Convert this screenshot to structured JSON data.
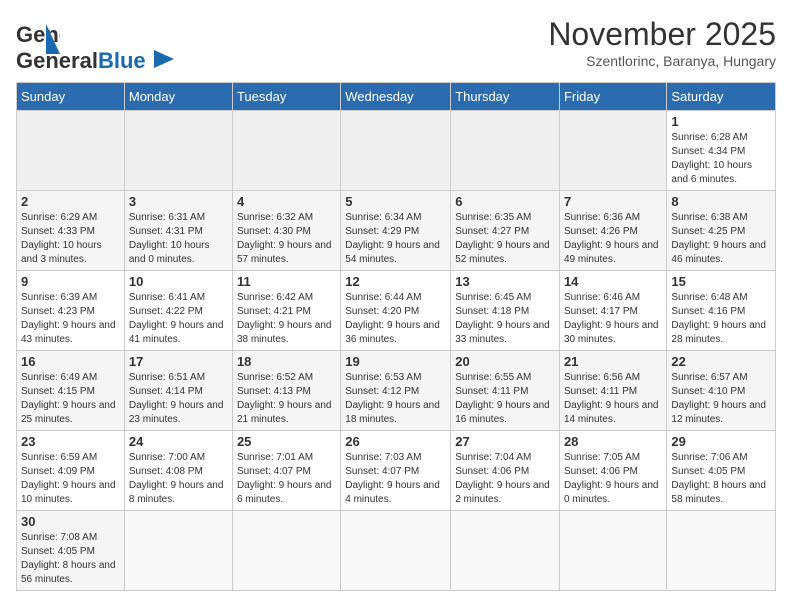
{
  "header": {
    "logo_general": "General",
    "logo_blue": "Blue",
    "month_title": "November 2025",
    "subtitle": "Szentlorinc, Baranya, Hungary"
  },
  "weekdays": [
    "Sunday",
    "Monday",
    "Tuesday",
    "Wednesday",
    "Thursday",
    "Friday",
    "Saturday"
  ],
  "weeks": [
    [
      {
        "day": "",
        "info": ""
      },
      {
        "day": "",
        "info": ""
      },
      {
        "day": "",
        "info": ""
      },
      {
        "day": "",
        "info": ""
      },
      {
        "day": "",
        "info": ""
      },
      {
        "day": "",
        "info": ""
      },
      {
        "day": "1",
        "info": "Sunrise: 6:28 AM\nSunset: 4:34 PM\nDaylight: 10 hours and 6 minutes."
      }
    ],
    [
      {
        "day": "2",
        "info": "Sunrise: 6:29 AM\nSunset: 4:33 PM\nDaylight: 10 hours and 3 minutes."
      },
      {
        "day": "3",
        "info": "Sunrise: 6:31 AM\nSunset: 4:31 PM\nDaylight: 10 hours and 0 minutes."
      },
      {
        "day": "4",
        "info": "Sunrise: 6:32 AM\nSunset: 4:30 PM\nDaylight: 9 hours and 57 minutes."
      },
      {
        "day": "5",
        "info": "Sunrise: 6:34 AM\nSunset: 4:29 PM\nDaylight: 9 hours and 54 minutes."
      },
      {
        "day": "6",
        "info": "Sunrise: 6:35 AM\nSunset: 4:27 PM\nDaylight: 9 hours and 52 minutes."
      },
      {
        "day": "7",
        "info": "Sunrise: 6:36 AM\nSunset: 4:26 PM\nDaylight: 9 hours and 49 minutes."
      },
      {
        "day": "8",
        "info": "Sunrise: 6:38 AM\nSunset: 4:25 PM\nDaylight: 9 hours and 46 minutes."
      }
    ],
    [
      {
        "day": "9",
        "info": "Sunrise: 6:39 AM\nSunset: 4:23 PM\nDaylight: 9 hours and 43 minutes."
      },
      {
        "day": "10",
        "info": "Sunrise: 6:41 AM\nSunset: 4:22 PM\nDaylight: 9 hours and 41 minutes."
      },
      {
        "day": "11",
        "info": "Sunrise: 6:42 AM\nSunset: 4:21 PM\nDaylight: 9 hours and 38 minutes."
      },
      {
        "day": "12",
        "info": "Sunrise: 6:44 AM\nSunset: 4:20 PM\nDaylight: 9 hours and 36 minutes."
      },
      {
        "day": "13",
        "info": "Sunrise: 6:45 AM\nSunset: 4:18 PM\nDaylight: 9 hours and 33 minutes."
      },
      {
        "day": "14",
        "info": "Sunrise: 6:46 AM\nSunset: 4:17 PM\nDaylight: 9 hours and 30 minutes."
      },
      {
        "day": "15",
        "info": "Sunrise: 6:48 AM\nSunset: 4:16 PM\nDaylight: 9 hours and 28 minutes."
      }
    ],
    [
      {
        "day": "16",
        "info": "Sunrise: 6:49 AM\nSunset: 4:15 PM\nDaylight: 9 hours and 25 minutes."
      },
      {
        "day": "17",
        "info": "Sunrise: 6:51 AM\nSunset: 4:14 PM\nDaylight: 9 hours and 23 minutes."
      },
      {
        "day": "18",
        "info": "Sunrise: 6:52 AM\nSunset: 4:13 PM\nDaylight: 9 hours and 21 minutes."
      },
      {
        "day": "19",
        "info": "Sunrise: 6:53 AM\nSunset: 4:12 PM\nDaylight: 9 hours and 18 minutes."
      },
      {
        "day": "20",
        "info": "Sunrise: 6:55 AM\nSunset: 4:11 PM\nDaylight: 9 hours and 16 minutes."
      },
      {
        "day": "21",
        "info": "Sunrise: 6:56 AM\nSunset: 4:11 PM\nDaylight: 9 hours and 14 minutes."
      },
      {
        "day": "22",
        "info": "Sunrise: 6:57 AM\nSunset: 4:10 PM\nDaylight: 9 hours and 12 minutes."
      }
    ],
    [
      {
        "day": "23",
        "info": "Sunrise: 6:59 AM\nSunset: 4:09 PM\nDaylight: 9 hours and 10 minutes."
      },
      {
        "day": "24",
        "info": "Sunrise: 7:00 AM\nSunset: 4:08 PM\nDaylight: 9 hours and 8 minutes."
      },
      {
        "day": "25",
        "info": "Sunrise: 7:01 AM\nSunset: 4:07 PM\nDaylight: 9 hours and 6 minutes."
      },
      {
        "day": "26",
        "info": "Sunrise: 7:03 AM\nSunset: 4:07 PM\nDaylight: 9 hours and 4 minutes."
      },
      {
        "day": "27",
        "info": "Sunrise: 7:04 AM\nSunset: 4:06 PM\nDaylight: 9 hours and 2 minutes."
      },
      {
        "day": "28",
        "info": "Sunrise: 7:05 AM\nSunset: 4:06 PM\nDaylight: 9 hours and 0 minutes."
      },
      {
        "day": "29",
        "info": "Sunrise: 7:06 AM\nSunset: 4:05 PM\nDaylight: 8 hours and 58 minutes."
      }
    ],
    [
      {
        "day": "30",
        "info": "Sunrise: 7:08 AM\nSunset: 4:05 PM\nDaylight: 8 hours and 56 minutes."
      },
      {
        "day": "",
        "info": ""
      },
      {
        "day": "",
        "info": ""
      },
      {
        "day": "",
        "info": ""
      },
      {
        "day": "",
        "info": ""
      },
      {
        "day": "",
        "info": ""
      },
      {
        "day": "",
        "info": ""
      }
    ]
  ]
}
